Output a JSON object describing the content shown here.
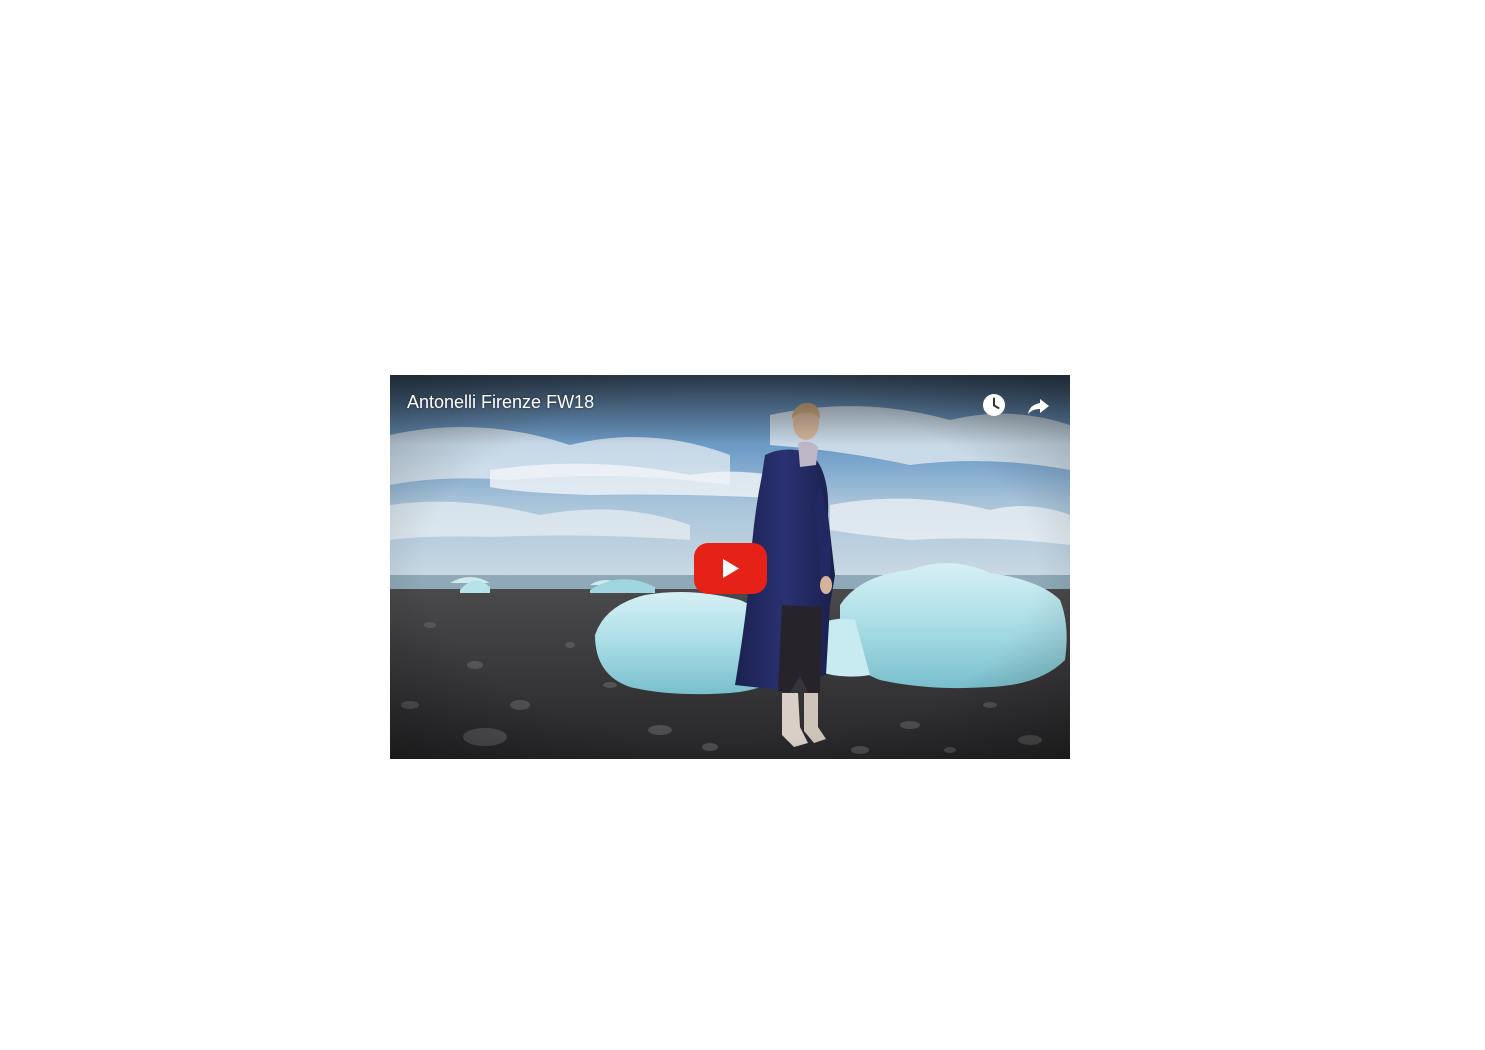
{
  "video": {
    "title": "Antonelli Firenze FW18",
    "controls": {
      "watch_later_icon": "clock-icon",
      "share_icon": "share-arrow-icon",
      "play_icon": "youtube-play-icon"
    }
  },
  "colors": {
    "play_button_red": "#e62117",
    "overlay_text": "#ffffff"
  }
}
